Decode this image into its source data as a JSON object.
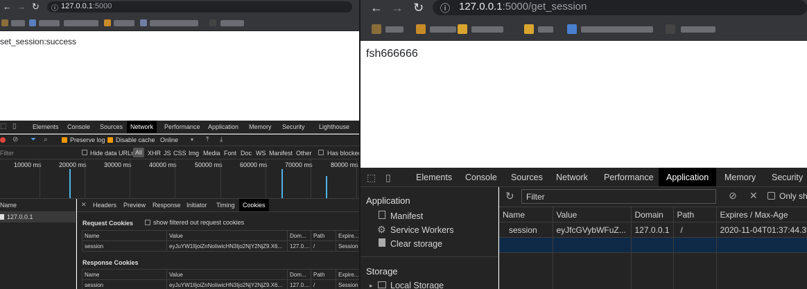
{
  "left": {
    "url_host": "127.0.0.1",
    "url_port": ":5000",
    "page_text": "set_session:success",
    "devtools": {
      "tabs": [
        "Elements",
        "Console",
        "Sources",
        "Network",
        "Performance",
        "Application",
        "Memory",
        "Security",
        "Lighthouse"
      ],
      "active_tab": "Network",
      "toolbar": {
        "preserve_log": "Preserve log",
        "disable_cache": "Disable cache",
        "throttle": "Online"
      },
      "filter": {
        "placeholder": "Filter",
        "hide_data_urls": "Hide data URLs",
        "all": "All",
        "types": [
          "XHR",
          "JS",
          "CSS",
          "Img",
          "Media",
          "Font",
          "Doc",
          "WS",
          "Manifest",
          "Other"
        ],
        "has_blocked": "Has blocked"
      },
      "timeline": [
        "10000 ms",
        "20000 ms",
        "30000 ms",
        "40000 ms",
        "50000 ms",
        "60000 ms",
        "70000 ms",
        "80000 ms"
      ],
      "name_header": "Name",
      "request_name": "127.0.0.1",
      "detail_tabs": [
        "Headers",
        "Preview",
        "Response",
        "Initiator",
        "Timing",
        "Cookies"
      ],
      "active_detail_tab": "Cookies",
      "request_cookies": {
        "title": "Request Cookies",
        "show_filtered": "show filtered out request cookies",
        "headers": [
          "Name",
          "Value",
          "Dom...",
          "Path",
          "Expire..."
        ],
        "row": [
          "session",
          "eyJuYW1lIjoiZnNoIiwicHN3Ijo2NjY2NjZ9.X6...",
          "127.0....",
          "/",
          "Session"
        ]
      },
      "response_cookies": {
        "title": "Response Cookies",
        "headers": [
          "Name",
          "Value",
          "Dom...",
          "Path",
          "Expire..."
        ],
        "row": [
          "session",
          "eyJuYW1lIjoiZnNoIiwicHN3Ijo2NjY2NjZ9.X6...",
          "127.0....",
          "/",
          "Session"
        ]
      }
    }
  },
  "right": {
    "url_host": "127.0.0.1",
    "url_port": ":5000",
    "url_path": "/get_session",
    "page_text": "fsh666666",
    "devtools": {
      "tabs": [
        "Elements",
        "Console",
        "Sources",
        "Network",
        "Performance",
        "Application",
        "Memory",
        "Security"
      ],
      "active_tab": "Application",
      "filter_placeholder": "Filter",
      "only_show": "Only sh",
      "sidebar": {
        "application_header": "Application",
        "items": [
          "Manifest",
          "Service Workers",
          "Clear storage"
        ],
        "storage_header": "Storage",
        "local_storage": "Local Storage"
      },
      "cookie_headers": [
        "Name",
        "Value",
        "Domain",
        "Path",
        "Expires / Max-Age"
      ],
      "cookie_row": [
        "session",
        "eyJfcGVybWFuZ...",
        "127.0.0.1",
        "/",
        "2020-11-04T01:37:44.39"
      ]
    }
  }
}
